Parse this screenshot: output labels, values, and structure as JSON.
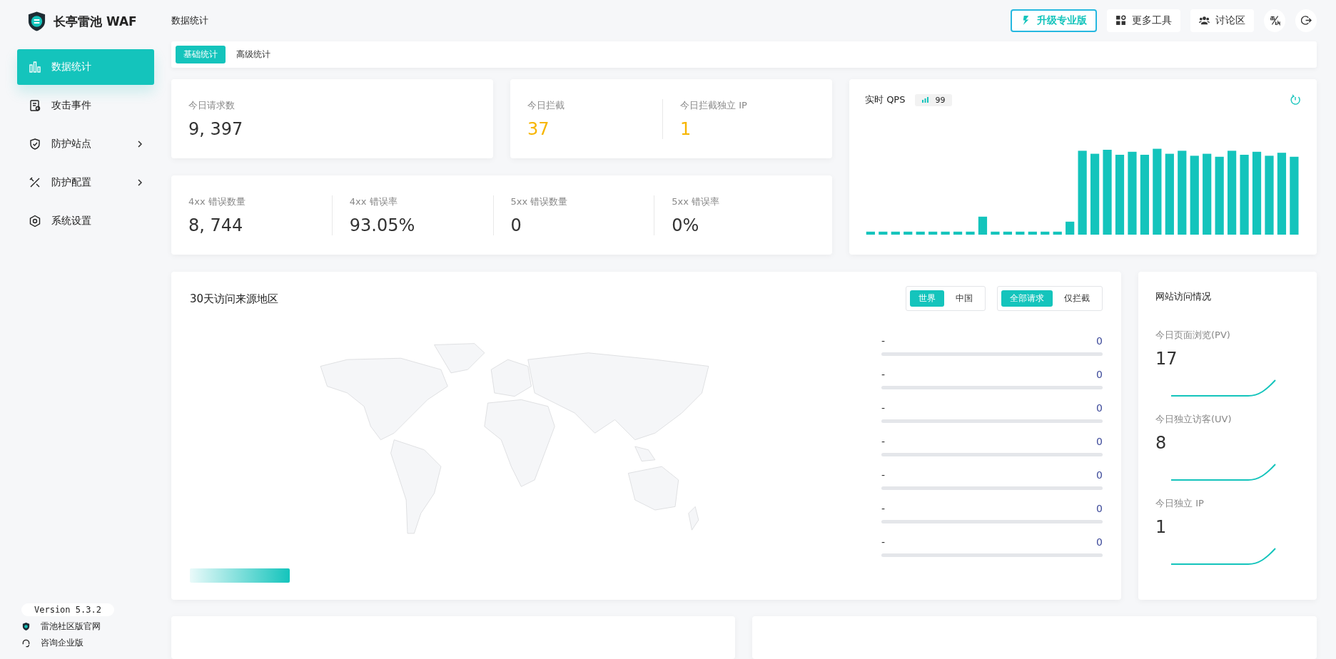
{
  "sidebar": {
    "brand": "长亭雷池 WAF",
    "items": [
      {
        "label": "数据统计",
        "selected": true,
        "has_submenu": false
      },
      {
        "label": "攻击事件",
        "selected": false,
        "has_submenu": false
      },
      {
        "label": "防护站点",
        "selected": false,
        "has_submenu": true
      },
      {
        "label": "防护配置",
        "selected": false,
        "has_submenu": true
      },
      {
        "label": "系统设置",
        "selected": false,
        "has_submenu": false
      }
    ],
    "version": "Version 5.3.2",
    "links": [
      {
        "label": "雷池社区版官网"
      },
      {
        "label": "咨询企业版"
      }
    ]
  },
  "header": {
    "title": "数据统计",
    "buttons": [
      {
        "kind": "upgrade",
        "label": "升级专业版"
      },
      {
        "kind": "tools",
        "label": "更多工具"
      },
      {
        "kind": "forum",
        "label": "讨论区"
      },
      {
        "kind": "lang"
      },
      {
        "kind": "logout"
      }
    ]
  },
  "tabs": [
    {
      "label": "基础统计",
      "selected": true
    },
    {
      "label": "高级统计",
      "selected": false
    }
  ],
  "requests": {
    "label": "今日请求数",
    "value": "9, 397"
  },
  "blocked": [
    {
      "label": "今日拦截",
      "value": "37"
    },
    {
      "label": "今日拦截独立 IP",
      "value": "1"
    }
  ],
  "errors": [
    {
      "label": "4xx 错误数量",
      "value": "8, 744"
    },
    {
      "label": "4xx 错误率",
      "value": "93.05%"
    },
    {
      "label": "5xx 错误数量",
      "value": "0"
    },
    {
      "label": "5xx 错误率",
      "value": "0%"
    }
  ],
  "qps": {
    "title": "实时 QPS",
    "badge": "99"
  },
  "map": {
    "title": "30天访问来源地区",
    "region_toggle": [
      {
        "label": "世界",
        "selected": true
      },
      {
        "label": "中国",
        "selected": false
      }
    ],
    "filter_toggle": [
      {
        "label": "全部请求",
        "selected": true
      },
      {
        "label": "仅拦截",
        "selected": false
      }
    ],
    "rows": [
      {
        "name": "-",
        "value": "0"
      },
      {
        "name": "-",
        "value": "0"
      },
      {
        "name": "-",
        "value": "0"
      },
      {
        "name": "-",
        "value": "0"
      },
      {
        "name": "-",
        "value": "0"
      },
      {
        "name": "-",
        "value": "0"
      },
      {
        "name": "-",
        "value": "0"
      }
    ]
  },
  "visits": {
    "title": "网站访问情况",
    "items": [
      {
        "label": "今日页面浏览(PV)",
        "value": "17"
      },
      {
        "label": "今日独立访客(UV)",
        "value": "8"
      },
      {
        "label": "今日独立 IP",
        "value": "1"
      }
    ]
  }
}
